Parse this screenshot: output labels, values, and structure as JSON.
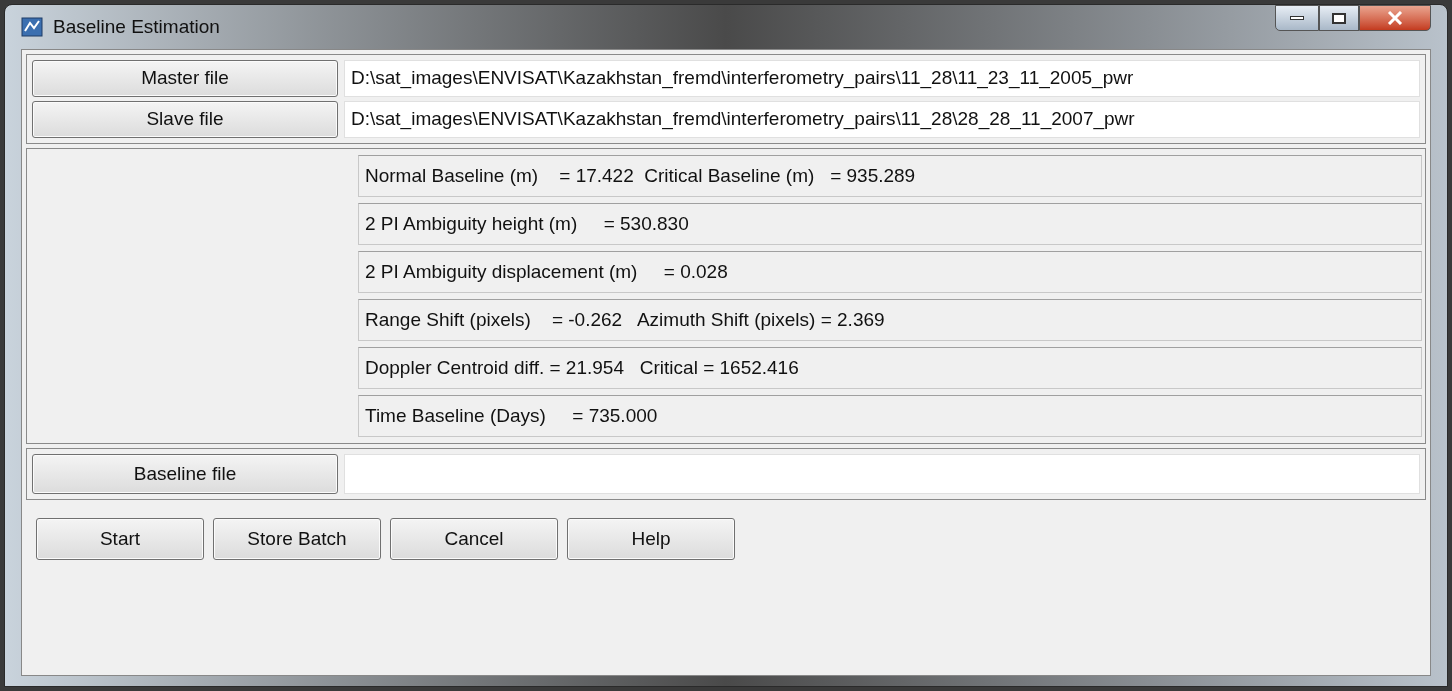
{
  "window": {
    "title": "Baseline Estimation"
  },
  "files": [
    {
      "button": "Master file",
      "value": "D:\\sat_images\\ENVISAT\\Kazakhstan_fremd\\interferometry_pairs\\11_28\\11_23_11_2005_pwr"
    },
    {
      "button": "Slave file",
      "value": "D:\\sat_images\\ENVISAT\\Kazakhstan_fremd\\interferometry_pairs\\11_28\\28_28_11_2007_pwr"
    }
  ],
  "results": [
    "Normal Baseline (m)    = 17.422  Critical Baseline (m)   = 935.289",
    "2 PI Ambiguity height (m)     = 530.830",
    "2 PI Ambiguity displacement (m)     = 0.028",
    "Range Shift (pixels)    = -0.262   Azimuth Shift (pixels) = 2.369",
    "Doppler Centroid diff. = 21.954   Critical = 1652.416",
    "Time Baseline (Days)     = 735.000"
  ],
  "baseline_file": {
    "button": "Baseline file"
  },
  "buttons": [
    "Start",
    "Store Batch",
    "Cancel",
    "Help"
  ]
}
